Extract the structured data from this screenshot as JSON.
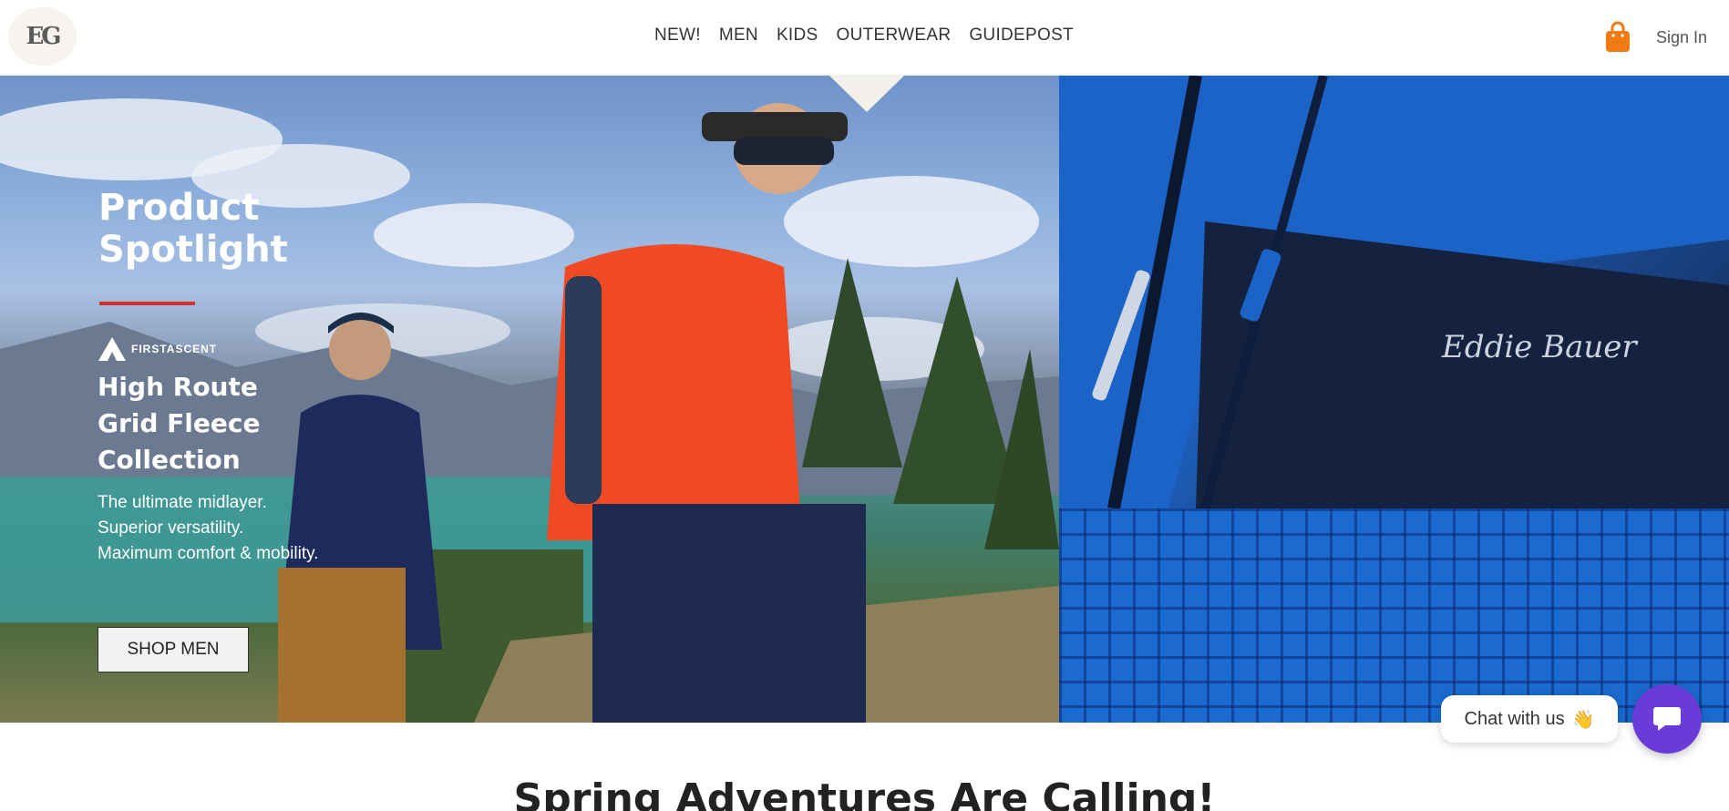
{
  "header": {
    "logo_text": "EG",
    "nav": [
      {
        "label": "NEW!"
      },
      {
        "label": "MEN"
      },
      {
        "label": "KIDS"
      },
      {
        "label": "OUTERWEAR"
      },
      {
        "label": "GUIDEPOST"
      }
    ],
    "cart_icon": "shopping-bag-icon",
    "sign_in_label": "Sign In"
  },
  "hero": {
    "title_line1": "Product",
    "title_line2": "Spotlight",
    "brand_label": "FIRSTASCENT",
    "collection_line1": "High Route",
    "collection_line2": "Grid Fleece",
    "collection_line3": "Collection",
    "desc_line1": "The ultimate midlayer.",
    "desc_line2": "Superior versatility.",
    "desc_line3": "Maximum comfort & mobility.",
    "cta_label": "SHOP MEN",
    "fleece_logo_text": "Eddie Bauer"
  },
  "chat": {
    "pill_label": "Chat with us",
    "pill_emoji": "👋",
    "button_icon": "chat-bubble-icon"
  },
  "section": {
    "heading": "Spring Adventures Are Calling!"
  },
  "colors": {
    "accent_red": "#d3322f",
    "chat_purple": "#6a3bd8",
    "cart_orange": "#f07b15"
  }
}
